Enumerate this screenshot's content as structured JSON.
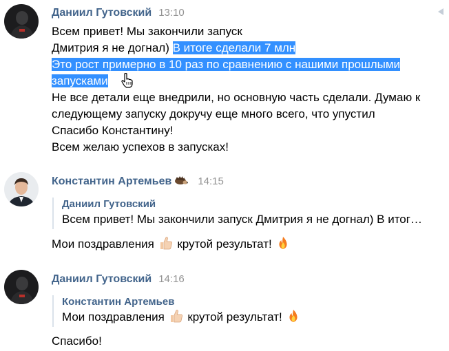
{
  "messages": [
    {
      "author": "Даниил Гутовский",
      "time": "13:10",
      "lines": {
        "l1": "Всем привет! Мы закончили запуск",
        "l2_plain": "Дмитрия я не догнал) ",
        "l2_sel": "В итоге сделали 7 млн",
        "l3_sel": "Это рост примерно в 10 раз по сравнению с нашими прошлыми",
        "l4_sel": "запусками",
        "l5": "Не все детали еще внедрили, но основную часть сделали. Думаю к",
        "l6": "следующему запуску докручу еще много всего, что упустил",
        "l7": "Спасибо Константину!",
        "l8": "Всем желаю успехов в запусках!"
      }
    },
    {
      "author": "Константин Артемьев",
      "time": "14:15",
      "quote_author": "Даниил Гутовский",
      "quote_text": "Всем привет! Мы закончили запуск Дмитрия я не догнал) В итог…",
      "text_before": "Мои поздравления",
      "text_after": "крутой результат!"
    },
    {
      "author": "Даниил Гутовский",
      "time": "14:16",
      "quote_author": "Константин Артемьев",
      "quote_text_before": "Мои поздравления",
      "quote_text_after": "крутой результат!",
      "text": "Спасибо!"
    }
  ],
  "icons": {
    "thumbs_up": "thumbs-up-emoji",
    "fire": "fire-emoji",
    "hedgehog": "hedgehog-emoji",
    "pointer": "hand-pointer-cursor",
    "check": "sent-check-icon"
  },
  "colors": {
    "author": "#42648b",
    "time": "#939393",
    "selection": "#3390ff",
    "quote_border": "#dae2ea"
  }
}
